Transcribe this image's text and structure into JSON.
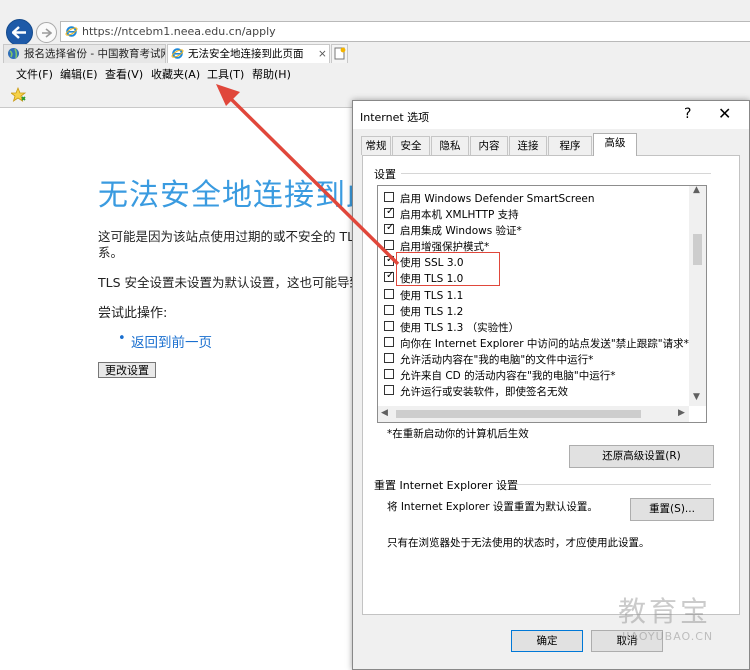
{
  "browser": {
    "url": "https://ntcebm1.neea.edu.cn/apply",
    "tabs": [
      {
        "label": "报名选择省份 - 中国教育考试网",
        "active": false
      },
      {
        "label": "无法安全地连接到此页面",
        "active": true
      }
    ],
    "menu": [
      "文件(F)",
      "编辑(E)",
      "查看(V)",
      "收藏夹(A)",
      "工具(T)",
      "帮助(H)"
    ]
  },
  "page": {
    "title": "无法安全地连接到此",
    "para1_line1": "这可能是因为该站点使用过期的或不安全的 TLS",
    "para1_line2": "系。",
    "para2": "TLS 安全设置未设置为默认设置，这也可能导致",
    "try_heading": "尝试此操作:",
    "back_link": "返回到前一页",
    "change_settings_button": "更改设置"
  },
  "dialog": {
    "title": "Internet 选项",
    "help_glyph": "?",
    "close_glyph": "✕",
    "tabs": [
      "常规",
      "安全",
      "隐私",
      "内容",
      "连接",
      "程序",
      "高级"
    ],
    "active_tab": "高级",
    "settings_group": "设置",
    "settings_items": [
      {
        "label": "启用 Windows Defender SmartScreen",
        "checked": false
      },
      {
        "label": "启用本机 XMLHTTP 支持",
        "checked": true
      },
      {
        "label": "启用集成 Windows 验证*",
        "checked": true
      },
      {
        "label": "启用增强保护模式*",
        "checked": false
      },
      {
        "label": "使用 SSL 3.0",
        "checked": true
      },
      {
        "label": "使用 TLS 1.0",
        "checked": true
      },
      {
        "label": "使用 TLS 1.1",
        "checked": false
      },
      {
        "label": "使用 TLS 1.2",
        "checked": false
      },
      {
        "label": "使用 TLS 1.3 （实验性）",
        "checked": false
      },
      {
        "label": "向你在 Internet Explorer 中访问的站点发送\"禁止跟踪\"请求*",
        "checked": false
      },
      {
        "label": "允许活动内容在\"我的电脑\"的文件中运行*",
        "checked": false
      },
      {
        "label": "允许来自 CD 的活动内容在\"我的电脑\"中运行*",
        "checked": false
      },
      {
        "label": "允许运行或安装软件，即使签名无效",
        "checked": false
      }
    ],
    "restart_note": "*在重新启动你的计算机后生效",
    "restore_button": "还原高级设置(R)",
    "reset_group": "重置 Internet Explorer 设置",
    "reset_desc": "将 Internet Explorer 设置重置为默认设置。",
    "reset_button": "重置(S)...",
    "reset_note": "只有在浏览器处于无法使用的状态时，才应使用此设置。",
    "ok_button": "确定",
    "cancel_button": "取消"
  },
  "watermark": {
    "main": "教育宝",
    "sub": "JIAOYUBAO.CN"
  },
  "colors": {
    "accent_blue": "#1e5aa8",
    "error_title": "#3a9be0",
    "annotation_red": "#e0473b"
  }
}
